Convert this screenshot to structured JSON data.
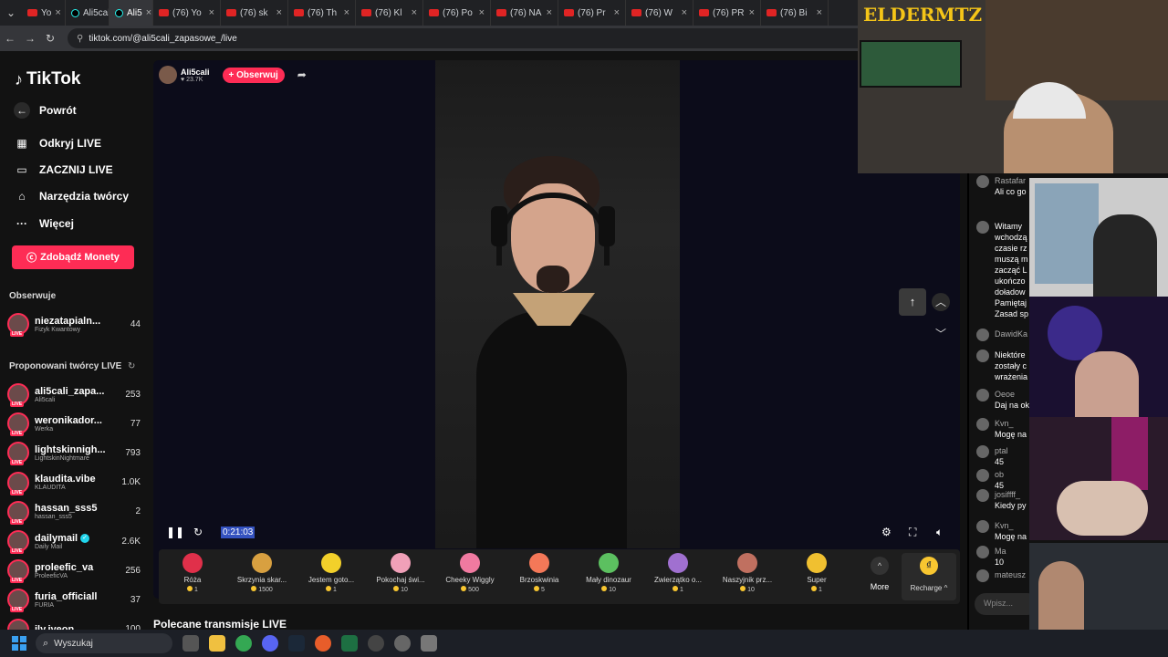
{
  "browser": {
    "tabs": [
      {
        "label": "Yo",
        "type": "youtube"
      },
      {
        "label": "Ali5cali",
        "type": "tiktok"
      },
      {
        "label": "Ali5",
        "type": "tiktok",
        "active": true
      },
      {
        "label": "(76) Yo",
        "type": "youtube"
      },
      {
        "label": "(76) sk",
        "type": "youtube"
      },
      {
        "label": "(76) Th",
        "type": "youtube"
      },
      {
        "label": "(76) Kl",
        "type": "youtube"
      },
      {
        "label": "(76) Po",
        "type": "youtube"
      },
      {
        "label": "(76) NA",
        "type": "youtube"
      },
      {
        "label": "(76) Pr",
        "type": "youtube"
      },
      {
        "label": "(76) W",
        "type": "youtube"
      },
      {
        "label": "(76) PR",
        "type": "youtube"
      },
      {
        "label": "(76) Bi",
        "type": "youtube"
      }
    ],
    "url": "tiktok.com/@ali5cali_zapasowe_/live"
  },
  "sidebar": {
    "brand": "TikTok",
    "nav": [
      {
        "label": "Powrót",
        "icon": "back-arrow-icon"
      },
      {
        "label": "Odkryj LIVE",
        "icon": "calendar-icon"
      },
      {
        "label": "ZACZNIJ LIVE",
        "icon": "camera-icon"
      },
      {
        "label": "Narzędzia twórcy",
        "icon": "home-icon"
      },
      {
        "label": "Więcej",
        "icon": "more-dots-icon"
      }
    ],
    "coins_button": "Zdobądź Monety",
    "following_header": "Obserwuje",
    "following": [
      {
        "name": "niezatapialn...",
        "sub": "Fizyk Kwantowy",
        "count": "44"
      }
    ],
    "suggested_header": "Proponowani twórcy LIVE",
    "suggested": [
      {
        "name": "ali5cali_zapa...",
        "sub": "Ali5cali",
        "count": "253"
      },
      {
        "name": "weronikador...",
        "sub": "Werka",
        "count": "77"
      },
      {
        "name": "lightskinnigh...",
        "sub": "LightskinNightmare",
        "count": "793"
      },
      {
        "name": "klaudita.vibe",
        "sub": "KLAUDITA",
        "count": "1.0K"
      },
      {
        "name": "hassan_sss5",
        "sub": "hassan_sss5",
        "count": "2"
      },
      {
        "name": "dailymail",
        "sub": "Daily Mail",
        "count": "2.6K",
        "verified": true
      },
      {
        "name": "proleefic_va",
        "sub": "ProleeficVA",
        "count": "256"
      },
      {
        "name": "furia_officiall",
        "sub": "FURIA",
        "count": "37"
      },
      {
        "name": "ily.iyeon",
        "sub": "",
        "count": "100"
      }
    ]
  },
  "stream": {
    "host_name": "Ali5cali",
    "host_likes": "23.7K",
    "follow_label": "+ Obserwuj",
    "elapsed": "0:21:03"
  },
  "gifts": [
    {
      "name": "Róża",
      "price": "1",
      "color": "#e0304a"
    },
    {
      "name": "Skrzynia skar...",
      "price": "1500",
      "color": "#d8a040"
    },
    {
      "name": "Jestem goto...",
      "price": "1",
      "color": "#f2d02a"
    },
    {
      "name": "Pokochaj świ...",
      "price": "10",
      "color": "#f0a0b8"
    },
    {
      "name": "Cheeky Wiggly",
      "price": "500",
      "color": "#f07aa0"
    },
    {
      "name": "Brzoskwinia",
      "price": "5",
      "color": "#f47858"
    },
    {
      "name": "Mały dinozaur",
      "price": "10",
      "color": "#5cc060"
    },
    {
      "name": "Zwierzątko o...",
      "price": "1",
      "color": "#a070d0"
    },
    {
      "name": "Naszyjnik prz...",
      "price": "10",
      "color": "#c07060"
    },
    {
      "name": "Super",
      "price": "1",
      "color": "#f0c030"
    }
  ],
  "gift_more": "More",
  "recharge_label": "Recharge",
  "section_title": "Polecane transmisje LIVE",
  "overlay": {
    "elder_text": "ELDERMTZ"
  },
  "chat": {
    "messages": [
      {
        "user": "Rastafar",
        "text": "Ali co go"
      },
      {
        "user": "",
        "text": "Witamy wchodzą czasie rz muszą m zacząć L ukończo doładow Pamiętaj Zasad sp"
      },
      {
        "user": "DawidKa",
        "text": ""
      },
      {
        "user": "",
        "text": "Niektóre zostały c wrażenia"
      },
      {
        "user": "Oeoe",
        "text": "Daj na ok"
      },
      {
        "user": "Kvn_",
        "text": "Mogę na"
      },
      {
        "user": "ptal",
        "text": "45"
      },
      {
        "user": "ob",
        "text": "45"
      },
      {
        "user": "josiffff_",
        "text": "Kiedy py"
      },
      {
        "user": "Kvn_",
        "text": "Mogę na"
      },
      {
        "user": "Ma",
        "text": "10"
      },
      {
        "user": "mateusz",
        "text": ""
      }
    ],
    "input_placeholder": "Wpisz..."
  },
  "taskbar": {
    "search_label": "Wyszukaj"
  }
}
